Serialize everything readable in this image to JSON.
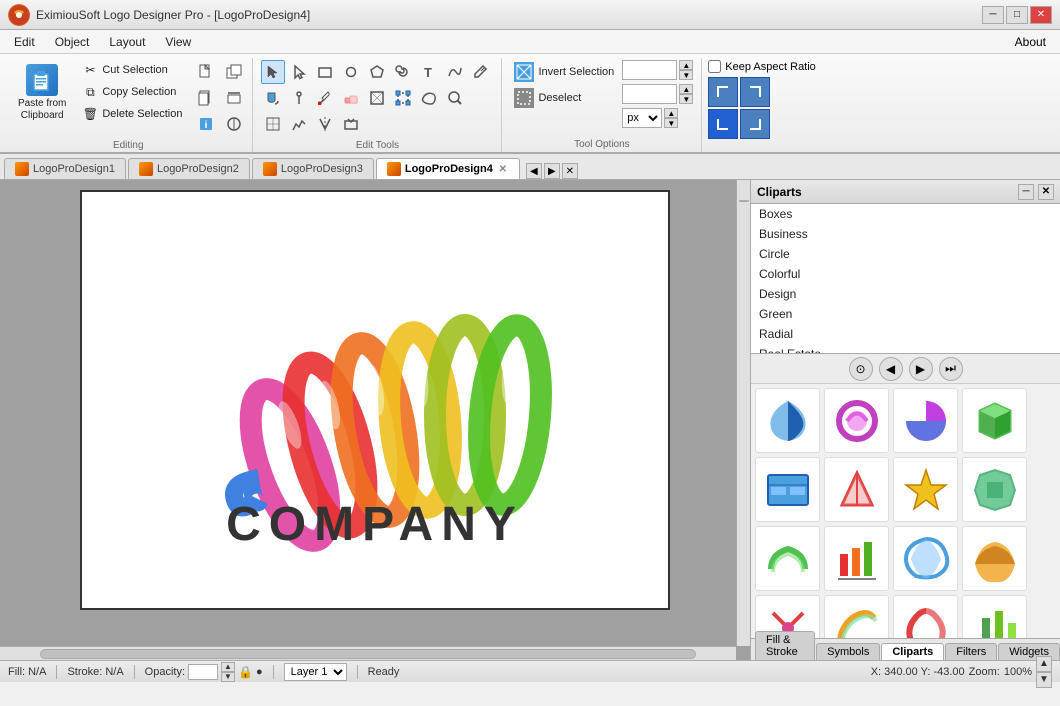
{
  "window": {
    "title": "EximiouSoft Logo Designer Pro - [LogoProDesign4]",
    "icon": "app-icon"
  },
  "winControls": {
    "minimize": "─",
    "maximize": "□",
    "close": "✕"
  },
  "menuBar": {
    "items": [
      "Edit",
      "Object",
      "Layout",
      "View"
    ],
    "about": "About"
  },
  "ribbon": {
    "groups": {
      "editing": {
        "label": "Editing",
        "cutSelection": "Cut Selection",
        "copySelection": "Copy Selection",
        "deleteSelection": "Delete Selection",
        "pasteFromClipboard": "Paste from Clipboard"
      },
      "editTools": {
        "label": "Edit Tools"
      },
      "selection": {
        "invertSelection": "Invert Selection",
        "deselect": "Deselect"
      },
      "toolOptions": {
        "label": "Tool Options",
        "unit": "px",
        "keepAspectRatio": "Keep Aspect Ratio"
      }
    }
  },
  "tabs": [
    {
      "label": "LogoProDesign1",
      "active": false
    },
    {
      "label": "LogoProDesign2",
      "active": false
    },
    {
      "label": "LogoProDesign3",
      "active": false
    },
    {
      "label": "LogoProDesign4",
      "active": true
    }
  ],
  "canvas": {
    "companyText": "COMPANY"
  },
  "clipartsPanel": {
    "title": "Cliparts",
    "categories": [
      "Boxes",
      "Business",
      "Circle",
      "Colorful",
      "Design",
      "Green",
      "Radial",
      "Real Estate"
    ],
    "navButtons": [
      "⊙",
      "◀",
      "▶",
      "⏭"
    ]
  },
  "bottomTabs": [
    {
      "label": "Fill & Stroke"
    },
    {
      "label": "Symbols"
    },
    {
      "label": "Cliparts",
      "active": true
    },
    {
      "label": "Filters"
    },
    {
      "label": "Widgets"
    }
  ],
  "statusBar": {
    "fill": "N/A",
    "stroke": "N/A",
    "opacity": "",
    "layer": "Layer 1",
    "status": "Ready",
    "coordinates": "X: 340.00  Y: -43.00",
    "zoom": "100%"
  }
}
